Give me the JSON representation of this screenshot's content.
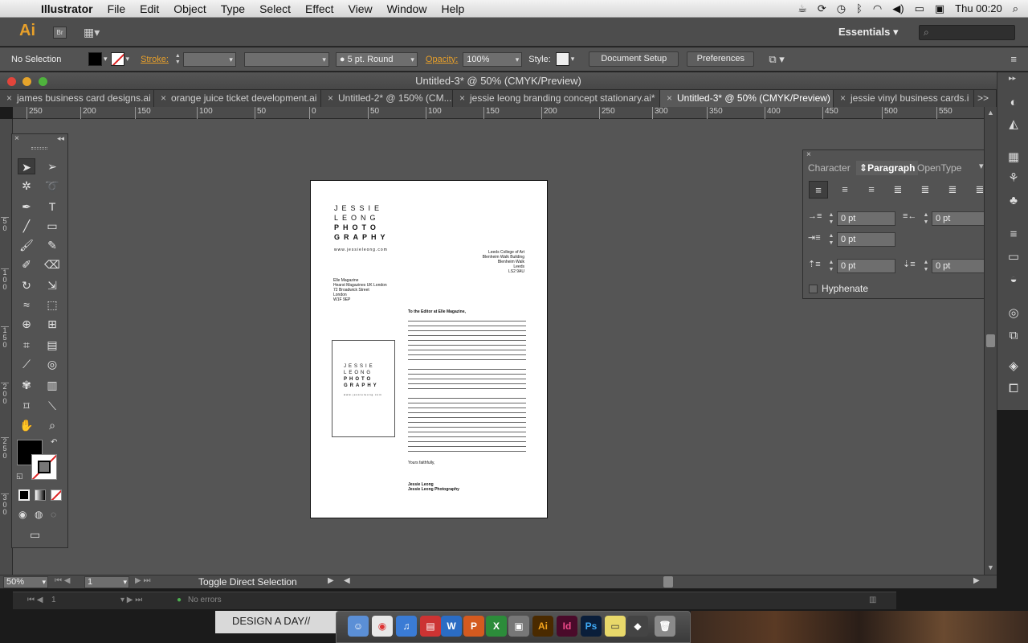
{
  "menubar": {
    "app": "Illustrator",
    "items": [
      "File",
      "Edit",
      "Object",
      "Type",
      "Select",
      "Effect",
      "View",
      "Window",
      "Help"
    ],
    "clock": "Thu 00:20"
  },
  "appbar": {
    "logo": "Ai",
    "bridge": "Br",
    "workspace": "Essentials"
  },
  "control": {
    "selection": "No Selection",
    "stroke_label": "Stroke:",
    "brush": "5 pt. Round",
    "opacity_label": "Opacity:",
    "opacity": "100%",
    "style_label": "Style:",
    "doc_setup": "Document Setup",
    "preferences": "Preferences"
  },
  "window": {
    "title": "Untitled-3* @ 50% (CMYK/Preview)"
  },
  "tabs": [
    {
      "label": "james business card designs.ai"
    },
    {
      "label": "orange juice ticket development.ai"
    },
    {
      "label": "Untitled-2* @ 150% (CM..."
    },
    {
      "label": "jessie leong branding concept stationary.ai*"
    },
    {
      "label": "Untitled-3* @ 50% (CMYK/Preview)"
    },
    {
      "label": "jessie vinyl business cards.i"
    }
  ],
  "tabs_more": ">>",
  "hruler": [
    "250",
    "200",
    "150",
    "100",
    "50",
    "0",
    "50",
    "100",
    "150",
    "200",
    "250",
    "300",
    "350",
    "400",
    "450",
    "500",
    "550"
  ],
  "vruler": [
    "5\n0",
    "1\n0\n0",
    "1\n5\n0",
    "2\n0\n0",
    "2\n5\n0",
    "3\n0\n0"
  ],
  "artboard": {
    "logo_lines": [
      "JESSIE",
      "LEONG",
      "PHOTO",
      "GRAPHY"
    ],
    "website": "www.jessieleong.com",
    "recipient_address": [
      "Leeds College of Art",
      "Blenheim Walk Building",
      "Blenheim Walk",
      "Leeds",
      "LS2 9AU"
    ],
    "sender_address": [
      "Elle Magazine",
      "Hearst Magazines UK London",
      "72 Broadwick Street",
      "London",
      "W1F 9EP"
    ],
    "salutation": "To the Editor at Elle Magazine,",
    "closing": "Yours faithfully,",
    "signature": [
      "Jessie Leong",
      "Jessie Leong Photography"
    ]
  },
  "paragraph_panel": {
    "tabs": [
      "Character",
      "Paragraph",
      "OpenType"
    ],
    "left_indent": "0 pt",
    "right_indent": "0 pt",
    "first_line": "0 pt",
    "space_before": "0 pt",
    "space_after": "0 pt",
    "hyphenate": "Hyphenate"
  },
  "status": {
    "zoom": "50%",
    "artboard": "1",
    "tool_hint": "Toggle Direct Selection"
  },
  "bg_window": {
    "page": "1",
    "errors": "No errors"
  },
  "taskbar": {
    "label": "DESIGN A DAY//"
  }
}
